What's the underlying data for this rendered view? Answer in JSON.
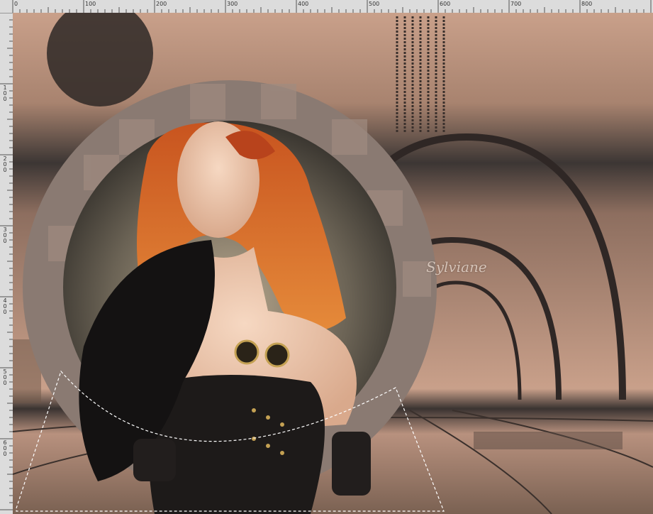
{
  "editor": {
    "ruler_top_labels": [
      "0",
      "100",
      "200",
      "300",
      "400",
      "500",
      "600",
      "700",
      "800"
    ],
    "ruler_left_labels": [
      "1 0 0",
      "2 0 0",
      "3 0 0",
      "4 0 0",
      "5 0 0",
      "6 0 0"
    ]
  },
  "artwork": {
    "signature": "Sylviane",
    "colors": {
      "sky_top": "#c9a08a",
      "sky_band_dark": "#3c3634",
      "floor": "#b8917e",
      "ring": "#8a7a72",
      "accent_dark": "#2a2422"
    }
  },
  "selection": {
    "style": "marching-ants"
  }
}
